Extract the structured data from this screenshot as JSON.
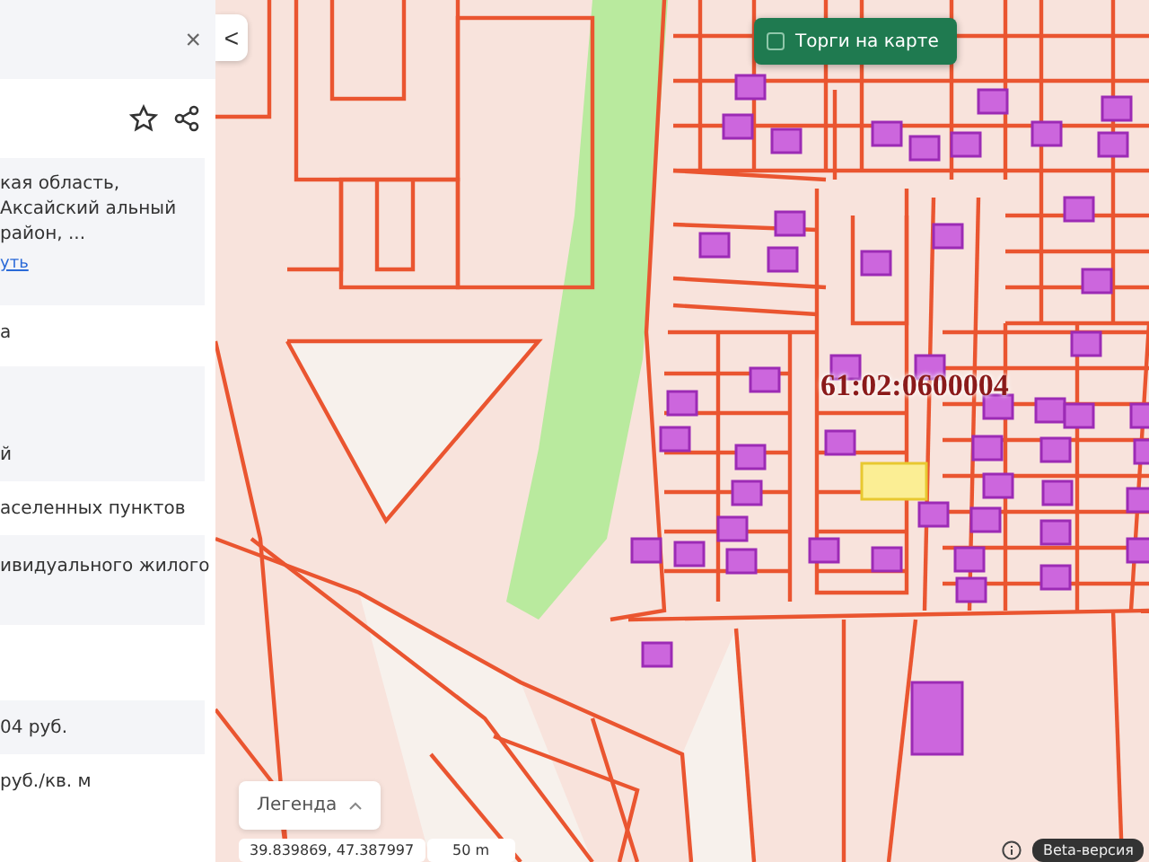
{
  "panel": {
    "close": "×",
    "address": "кая область,  Аксайский альный район, ...",
    "link": "уть",
    "rows": [
      {
        "kind": "plain",
        "text": "а"
      },
      {
        "kind": "blank"
      },
      {
        "kind": "card",
        "text": "й"
      },
      {
        "kind": "plain",
        "text": "аселенных пунктов"
      },
      {
        "kind": "card",
        "text": "ивидуального жилого"
      },
      {
        "kind": "gap"
      },
      {
        "kind": "card",
        "text": "04 руб."
      },
      {
        "kind": "plain",
        "text": "руб./кв. м"
      }
    ]
  },
  "map": {
    "back": "<",
    "auctions": {
      "label": "Торги на карте",
      "checked": false
    },
    "cadastral_label": "61:02:0600004",
    "legend": "Легенда",
    "coordinates": "39.839869, 47.387997",
    "scale": "50 m",
    "badge": "Beta-версия"
  }
}
